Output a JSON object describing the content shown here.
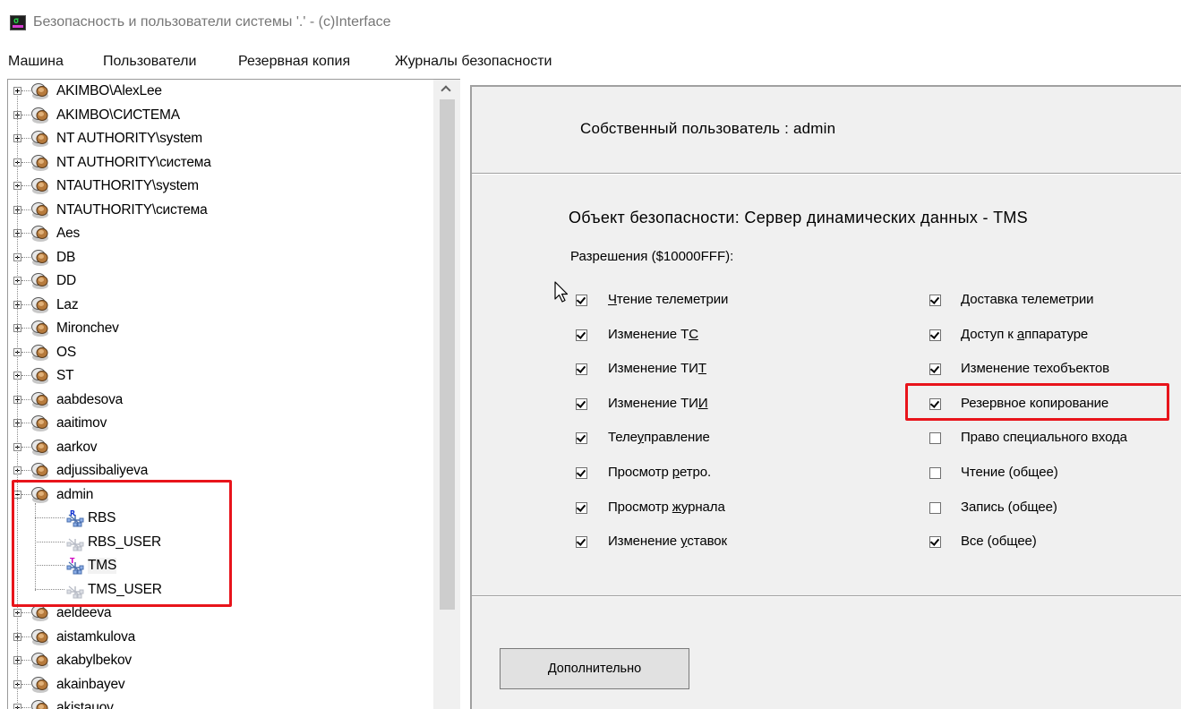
{
  "window": {
    "title": "Безопасность и пользователи системы '.' - (c)Interface"
  },
  "menu": [
    "Машина",
    "Пользователи",
    "Резервная копия",
    "Журналы безопасности"
  ],
  "tree": {
    "users_before": [
      "AKIMBO\\AlexLee",
      "AKIMBO\\СИСТЕМА",
      "NT AUTHORITY\\system",
      "NT AUTHORITY\\система",
      "NTAUTHORITY\\system",
      "NTAUTHORITY\\система",
      "Aes",
      "DB",
      "DD",
      "Laz",
      "Mironchev",
      "OS",
      "ST",
      "aabdesova",
      "aaitimov",
      "aarkov",
      "adjussibaliyeva"
    ],
    "expanded_user": "admin",
    "objects": [
      {
        "name": "RBS",
        "badge": "R",
        "active": true
      },
      {
        "name": "RBS_USER",
        "badge": "",
        "active": false
      },
      {
        "name": "TMS",
        "badge": "T",
        "active": true
      },
      {
        "name": "TMS_USER",
        "badge": "",
        "active": false
      }
    ],
    "users_after": [
      "aeldeeva",
      "aistamkulova",
      "akabylbekov",
      "akainbayev",
      "akistauov"
    ]
  },
  "details": {
    "owner": "Собственный пользователь :  admin",
    "object": "Объект безопасности: Сервер динамических данных  -  TMS",
    "permissions_label": "Разрешения ($10000FFF):",
    "left_permissions": [
      {
        "pre": "",
        "u": "Ч",
        "post": "тение телеметрии",
        "checked": true
      },
      {
        "pre": "Изменение Т",
        "u": "С",
        "post": "",
        "checked": true
      },
      {
        "pre": "Изменение ТИ",
        "u": "Т",
        "post": "",
        "checked": true
      },
      {
        "pre": "Изменение ТИ",
        "u": "И",
        "post": "",
        "checked": true
      },
      {
        "pre": "Теле",
        "u": "у",
        "post": "правление",
        "checked": true
      },
      {
        "pre": "Просмотр ",
        "u": "р",
        "post": "етро.",
        "checked": true
      },
      {
        "pre": "Просмотр ",
        "u": "ж",
        "post": "урнала",
        "checked": true
      },
      {
        "pre": "Изменение ",
        "u": "у",
        "post": "ставок",
        "checked": true
      }
    ],
    "right_permissions": [
      {
        "pre": "",
        "u": "Д",
        "post": "оставка телеметрии",
        "checked": true
      },
      {
        "pre": "Доступ к ",
        "u": "а",
        "post": "ппаратуре",
        "checked": true
      },
      {
        "pre": "Изменение техобъектов",
        "u": "",
        "post": "",
        "checked": true
      },
      {
        "pre": "Резервное копирование",
        "u": "",
        "post": "",
        "checked": true
      },
      {
        "pre": "Право специального входа",
        "u": "",
        "post": "",
        "checked": false
      },
      {
        "pre": "Чтение (общее)",
        "u": "",
        "post": "",
        "checked": false
      },
      {
        "pre": "Запись (общее)",
        "u": "",
        "post": "",
        "checked": false
      },
      {
        "pre": "Все (общее)",
        "u": "",
        "post": "",
        "checked": true
      }
    ],
    "more_button": "Дополнительно"
  },
  "colors": {
    "highlight": "#e8141b",
    "panel": "#f0f0f0"
  }
}
